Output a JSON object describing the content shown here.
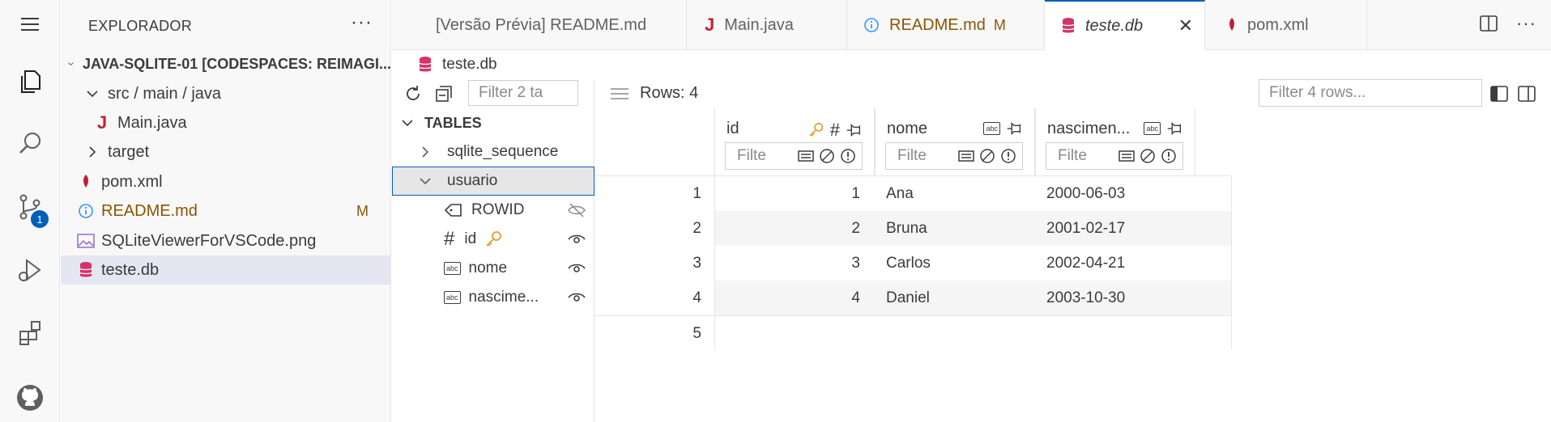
{
  "sidebar": {
    "title": "EXPLORADOR",
    "more": "···",
    "items": [
      {
        "label": "JAVA-SQLITE-01 [CODESPACES: REIMAGI...",
        "icon": "chevron-down"
      },
      {
        "label": "src / main / java",
        "icon": "chevron-down"
      },
      {
        "label": "Main.java",
        "icon": "java-file-icon"
      },
      {
        "label": "target",
        "icon": "chevron-right"
      },
      {
        "label": "pom.xml",
        "icon": "maven-icon"
      },
      {
        "label": "README.md",
        "icon": "info-icon",
        "status": "M"
      },
      {
        "label": "SQLiteViewerForVSCode.png",
        "icon": "image-icon"
      },
      {
        "label": "teste.db",
        "icon": "database-icon"
      }
    ]
  },
  "activity": {
    "badge": "1"
  },
  "tabs": [
    {
      "label": "[Versão Prévia] README.md"
    },
    {
      "label": "Main.java"
    },
    {
      "label": "README.md",
      "flag": "M"
    },
    {
      "label": "teste.db",
      "close": "✕"
    },
    {
      "label": "pom.xml"
    }
  ],
  "breadcrumb": {
    "label": "teste.db"
  },
  "db": {
    "tables_filter_placeholder": "Filter 2 ta",
    "rows_label": "Rows: 4",
    "rows_filter_placeholder": "Filter 4 rows...",
    "section_label": "TABLES",
    "tables": [
      {
        "label": "sqlite_sequence"
      },
      {
        "label": "usuario"
      }
    ],
    "columns": [
      {
        "label": "ROWID"
      },
      {
        "label": "id"
      },
      {
        "label": "nome"
      },
      {
        "label": "nascime..."
      }
    ],
    "grid_headers": [
      {
        "label": "id",
        "filter": "Filte"
      },
      {
        "label": "nome",
        "filter": "Filte"
      },
      {
        "label": "nascimen...",
        "filter": "Filte"
      }
    ],
    "rows": [
      {
        "n": "1",
        "id": "1",
        "nome": "Ana",
        "nascimento": "2000-06-03"
      },
      {
        "n": "2",
        "id": "2",
        "nome": "Bruna",
        "nascimento": "2001-02-17"
      },
      {
        "n": "3",
        "id": "3",
        "nome": "Carlos",
        "nascimento": "2002-04-21"
      },
      {
        "n": "4",
        "id": "4",
        "nome": "Daniel",
        "nascimento": "2003-10-30"
      },
      {
        "n": "5",
        "id": "",
        "nome": "",
        "nascimento": ""
      }
    ]
  },
  "colors": {
    "accent": "#005fb8",
    "modified": "#895503",
    "database": "#d6336c",
    "key": "#e0a030"
  }
}
